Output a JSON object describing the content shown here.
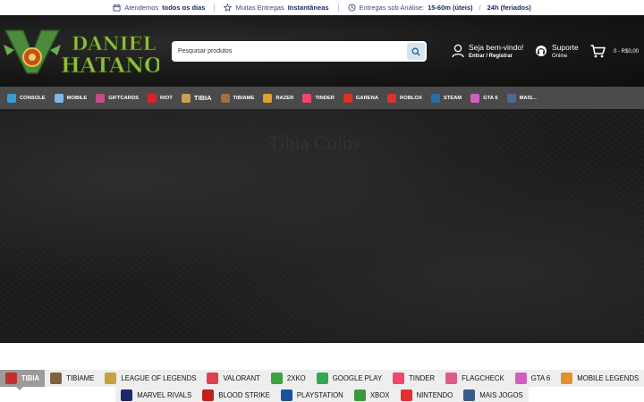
{
  "topbar": {
    "hours_prefix": "Atendemos",
    "hours_value": "todos os dias",
    "delivery_prefix": "Muitas Entregas",
    "delivery_value": "Instantâneas",
    "review_prefix": "Entregas sob Análise:",
    "review_value": "15-60m (úteis)",
    "review_sep": "/",
    "review_holiday": "24h (feriados)"
  },
  "header": {
    "logo_line1": "DANIEL",
    "logo_line2": "HATANO",
    "search_placeholder": "Pesquisar produtos",
    "account_title": "Seja bem-vindo!",
    "account_links": "Entrar / Registrar",
    "support_title": "Suporte",
    "support_status": "Online",
    "cart_total": "0 - R$0,00"
  },
  "nav": [
    {
      "label": "CONSOLE",
      "icon": "console-icon",
      "color": "#3a9bd8"
    },
    {
      "label": "MOBILE",
      "icon": "mobile-icon",
      "color": "#7fb6e8"
    },
    {
      "label": "GIFTCARDS",
      "icon": "giftcard-icon",
      "color": "#c94a8a"
    },
    {
      "label": "RIOT",
      "icon": "riot-icon",
      "color": "#d8202c"
    },
    {
      "label": "TIBIA",
      "icon": "tibia-icon",
      "color": "#c8a050",
      "big": true
    },
    {
      "label": "TIBIAME",
      "icon": "tibiame-icon",
      "color": "#a07040"
    },
    {
      "label": "RAZER",
      "icon": "razer-icon",
      "color": "#e0a030"
    },
    {
      "label": "TINDER",
      "icon": "tinder-icon",
      "color": "#f2456a"
    },
    {
      "label": "GARENA",
      "icon": "garena-icon",
      "color": "#e03020"
    },
    {
      "label": "ROBLOX",
      "icon": "roblox-icon",
      "color": "#e03030"
    },
    {
      "label": "STEAM",
      "icon": "steam-icon",
      "color": "#2a6ea8"
    },
    {
      "label": "GTA 6",
      "icon": "gta6-icon",
      "color": "#d060c0"
    },
    {
      "label": "MAIS...",
      "icon": "more-icon",
      "color": "#4a6a9a"
    }
  ],
  "hero": {
    "ghost_text": "Tibia Coins"
  },
  "tabs_row1": [
    {
      "label": "TIBIA",
      "icon": "tibia-icon",
      "color": "#c03030",
      "active": true
    },
    {
      "label": "TIBIAME",
      "icon": "tibiame-icon",
      "color": "#806040"
    },
    {
      "label": "LEAGUE OF LEGENDS",
      "icon": "lol-icon",
      "color": "#c8a040"
    },
    {
      "label": "VALORANT",
      "icon": "valorant-icon",
      "color": "#e04050"
    },
    {
      "label": "2XKO",
      "icon": "2xko-icon",
      "color": "#40a040"
    },
    {
      "label": "GOOGLE PLAY",
      "icon": "googleplay-icon",
      "color": "#34a853"
    },
    {
      "label": "TINDER",
      "icon": "tinder-icon",
      "color": "#f2456a"
    },
    {
      "label": "FLAGCHECK",
      "icon": "flagcheck-icon",
      "color": "#e05a8a"
    },
    {
      "label": "GTA 6",
      "icon": "gta6-icon",
      "color": "#d060c0"
    },
    {
      "label": "MOBILE LEGENDS",
      "icon": "mobilelegends-icon",
      "color": "#e09030"
    }
  ],
  "tabs_row2": [
    {
      "label": "MARVEL RIVALS",
      "icon": "marvelrivals-icon",
      "color": "#1a2a6a"
    },
    {
      "label": "BLOOD STRIKE",
      "icon": "bloodstrike-icon",
      "color": "#c02020"
    },
    {
      "label": "PLAYSTATION",
      "icon": "playstation-icon",
      "color": "#1a50a0"
    },
    {
      "label": "XBOX",
      "icon": "xbox-icon",
      "color": "#3a9a3a"
    },
    {
      "label": "NINTENDO",
      "icon": "nintendo-icon",
      "color": "#e03030"
    },
    {
      "label": "MAIS JOGOS",
      "icon": "more-games-icon",
      "color": "#3a5a8a"
    }
  ]
}
